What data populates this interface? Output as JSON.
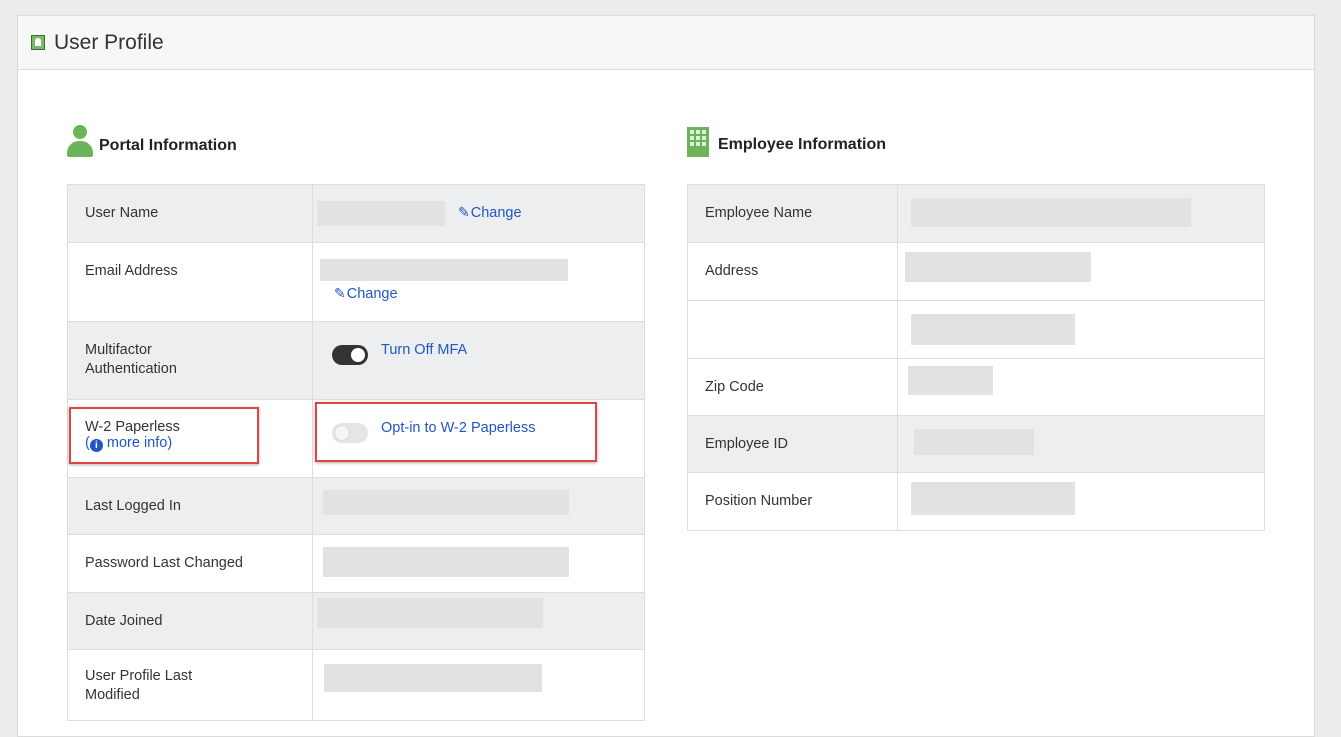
{
  "header": {
    "title": "User Profile"
  },
  "portal": {
    "title": "Portal Information",
    "rows": [
      {
        "label": "User Name",
        "change": "Change"
      },
      {
        "label": "Email Address",
        "change": "Change"
      },
      {
        "label": "Multifactor Authentication",
        "toggle_label": "Turn Off MFA",
        "toggle_state": "on"
      },
      {
        "label": "W-2 Paperless",
        "more_info": "more info",
        "toggle_label": "Opt-in to W-2 Paperless",
        "toggle_state": "off"
      },
      {
        "label": "Last Logged In"
      },
      {
        "label": "Password Last Changed"
      },
      {
        "label": "Date Joined"
      },
      {
        "label": "User Profile Last Modified"
      }
    ]
  },
  "employee": {
    "title": "Employee Information",
    "rows": [
      {
        "label": "Employee Name"
      },
      {
        "label": "Address"
      },
      {
        "label": ""
      },
      {
        "label": "Zip Code"
      },
      {
        "label": "Employee ID"
      },
      {
        "label": "Position Number"
      }
    ]
  },
  "colors": {
    "link": "#2156c4",
    "icon_green": "#6cb35c",
    "highlight": "#e04545"
  },
  "icons": {
    "header": "profile-card-icon",
    "portal": "person-icon",
    "employee": "building-icon",
    "edit": "edit-icon",
    "info": "info-icon"
  }
}
